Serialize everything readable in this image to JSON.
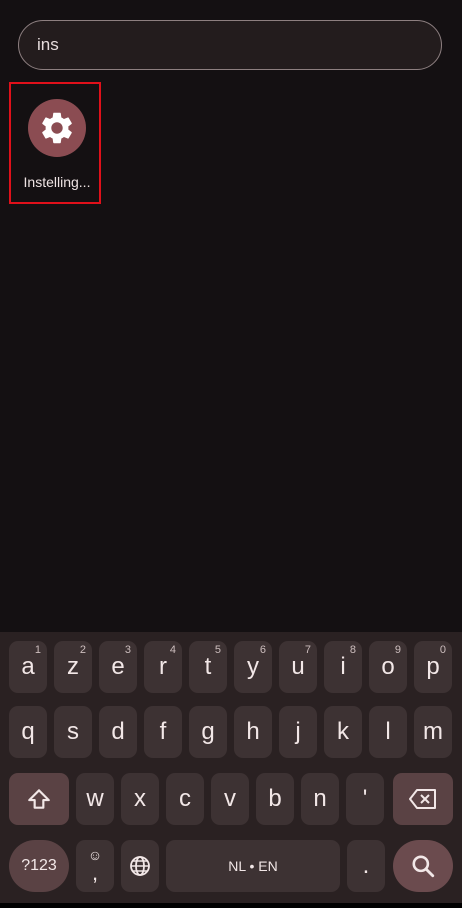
{
  "search": {
    "value": "ins",
    "placeholder": ""
  },
  "results": [
    {
      "label": "Instelling...",
      "icon": "settings-gear-icon"
    }
  ],
  "keyboard": {
    "row1": [
      {
        "key": "a",
        "hint": "1"
      },
      {
        "key": "z",
        "hint": "2"
      },
      {
        "key": "e",
        "hint": "3"
      },
      {
        "key": "r",
        "hint": "4"
      },
      {
        "key": "t",
        "hint": "5"
      },
      {
        "key": "y",
        "hint": "6"
      },
      {
        "key": "u",
        "hint": "7"
      },
      {
        "key": "i",
        "hint": "8"
      },
      {
        "key": "o",
        "hint": "9"
      },
      {
        "key": "p",
        "hint": "0"
      }
    ],
    "row2": [
      "q",
      "s",
      "d",
      "f",
      "g",
      "h",
      "j",
      "k",
      "l",
      "m"
    ],
    "row3": [
      "w",
      "x",
      "c",
      "v",
      "b",
      "n",
      "'"
    ],
    "symbols_label": "?123",
    "emoji_comma_top": "☺",
    "emoji_comma_bottom": ",",
    "space_label": "NL • EN",
    "period_label": "."
  },
  "colors": {
    "accent": "#8b4c52",
    "highlight_border": "#e0101a",
    "key": "#3d3233",
    "special_key": "#5a4244"
  }
}
